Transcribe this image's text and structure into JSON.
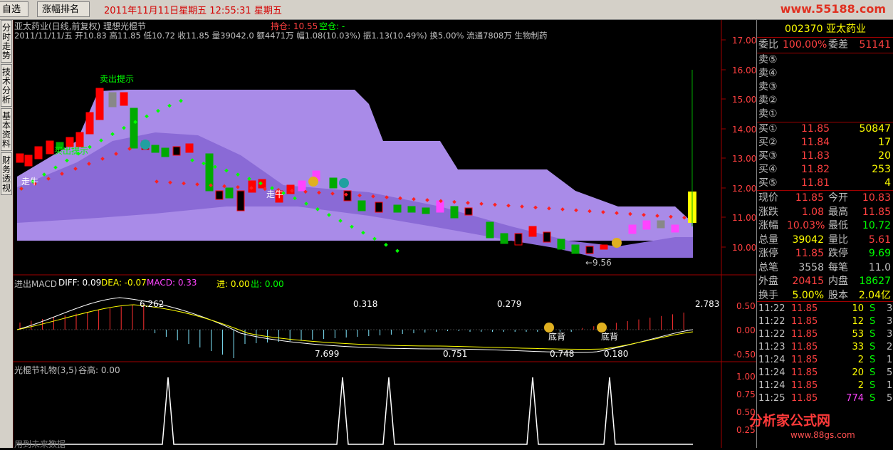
{
  "topbar": {
    "tabs": [
      "自选股",
      "涨幅排名"
    ],
    "datetime": "2011年11月11日星期五  12:55:31 星期五",
    "logo": "www.55188.com"
  },
  "sidetabs": [
    "分时走势",
    "技术分析",
    "基本资料",
    "财务透视"
  ],
  "main_chart": {
    "title": "亚太药业(日线,前复权) 理想光棍节",
    "position_label": "持仓: 10.55",
    "empty_label": "空仓: -",
    "info_line": "2011/11/11/五  开10.83 高11.85 低10.72 收11.85 量39042.0 额4471万 幅1.08(10.03%) 振1.13(10.49%) 换5.00% 流通7808万 生物制药",
    "price_axis": [
      "17.00",
      "16.00",
      "15.00",
      "14.00",
      "13.00",
      "12.00",
      "11.00",
      "10.00"
    ],
    "annotations": {
      "sell_hint": "卖出提示",
      "buy_hint": "买出提示",
      "walk1": "走牛",
      "walk2": "走牛",
      "low_price": "←9.56"
    }
  },
  "macd_panel": {
    "title": "进出MACD",
    "diff": "DIFF: 0.09",
    "dea": "DEA: -0.07",
    "macd": "MACD: 0.33",
    "in": "进: 0.00",
    "out": "出: 0.00",
    "labels": [
      "6.262",
      "0.318",
      "0.279",
      "2.783",
      "7.699",
      "0.751",
      "0.748",
      "0.180"
    ],
    "divergence": [
      "底背",
      "底背"
    ],
    "axis": [
      "0.50",
      "0.00",
      "-0.50"
    ]
  },
  "gift_panel": {
    "title": "光棍节礼物(3,5)",
    "value": "谷高: 0.00",
    "axis": [
      "1.00",
      "0.75",
      "0.50",
      "0.25"
    ],
    "footer": "用到未来数据"
  },
  "quote": {
    "code_name": "002370 亚太药业",
    "weibi_label": "委比",
    "weibi": "100.00%",
    "weicha_label": "委差",
    "weicha": "51141",
    "sells": [
      {
        "label": "卖⑤",
        "price": "",
        "vol": ""
      },
      {
        "label": "卖④",
        "price": "",
        "vol": ""
      },
      {
        "label": "卖③",
        "price": "",
        "vol": ""
      },
      {
        "label": "卖②",
        "price": "",
        "vol": ""
      },
      {
        "label": "卖①",
        "price": "",
        "vol": ""
      }
    ],
    "buys": [
      {
        "label": "买①",
        "price": "11.85",
        "vol": "50847"
      },
      {
        "label": "买②",
        "price": "11.84",
        "vol": "17"
      },
      {
        "label": "买③",
        "price": "11.83",
        "vol": "20"
      },
      {
        "label": "买④",
        "price": "11.82",
        "vol": "253"
      },
      {
        "label": "买⑤",
        "price": "11.81",
        "vol": "4"
      }
    ],
    "stats": [
      {
        "l1": "现价",
        "v1": "11.85",
        "l2": "今开",
        "v2": "10.83"
      },
      {
        "l1": "涨跌",
        "v1": "1.08",
        "l2": "最高",
        "v2": "11.85"
      },
      {
        "l1": "涨幅",
        "v1": "10.03%",
        "l2": "最低",
        "v2": "10.72"
      },
      {
        "l1": "总量",
        "v1": "39042",
        "l2": "量比",
        "v2": "5.61"
      },
      {
        "l1": "涨停",
        "v1": "11.85",
        "l2": "跌停",
        "v2": "9.69"
      },
      {
        "l1": "总笔",
        "v1": "3558",
        "l2": "每笔",
        "v2": "11.0"
      },
      {
        "l1": "外盘",
        "v1": "20415",
        "l2": "内盘",
        "v2": "18627"
      },
      {
        "l1": "换手",
        "v1": "5.00%",
        "l2": "股本",
        "v2": "2.04亿"
      }
    ],
    "ticks": [
      {
        "t": "11:22",
        "p": "11.85",
        "v": "10",
        "s": "S",
        "n": "3"
      },
      {
        "t": "11:22",
        "p": "11.85",
        "v": "12",
        "s": "S",
        "n": "3"
      },
      {
        "t": "11:22",
        "p": "11.85",
        "v": "53",
        "s": "S",
        "n": "3"
      },
      {
        "t": "11:23",
        "p": "11.85",
        "v": "33",
        "s": "S",
        "n": "2"
      },
      {
        "t": "11:24",
        "p": "11.85",
        "v": "2",
        "s": "S",
        "n": "1"
      },
      {
        "t": "11:24",
        "p": "11.85",
        "v": "20",
        "s": "S",
        "n": "5"
      },
      {
        "t": "11:24",
        "p": "11.85",
        "v": "2",
        "s": "S",
        "n": "1"
      },
      {
        "t": "11:25",
        "p": "11.85",
        "v": "774",
        "s": "S",
        "n": "5"
      }
    ],
    "watermark": "分析家公式网",
    "watermark_url": "www.88gs.com"
  },
  "colors": {
    "up": "#ff0000",
    "down": "#00ff00",
    "band_dark": "#7a5cc8",
    "band_light": "#a98be8",
    "pink": "#ff44ff",
    "yellow": "#ffff00"
  }
}
